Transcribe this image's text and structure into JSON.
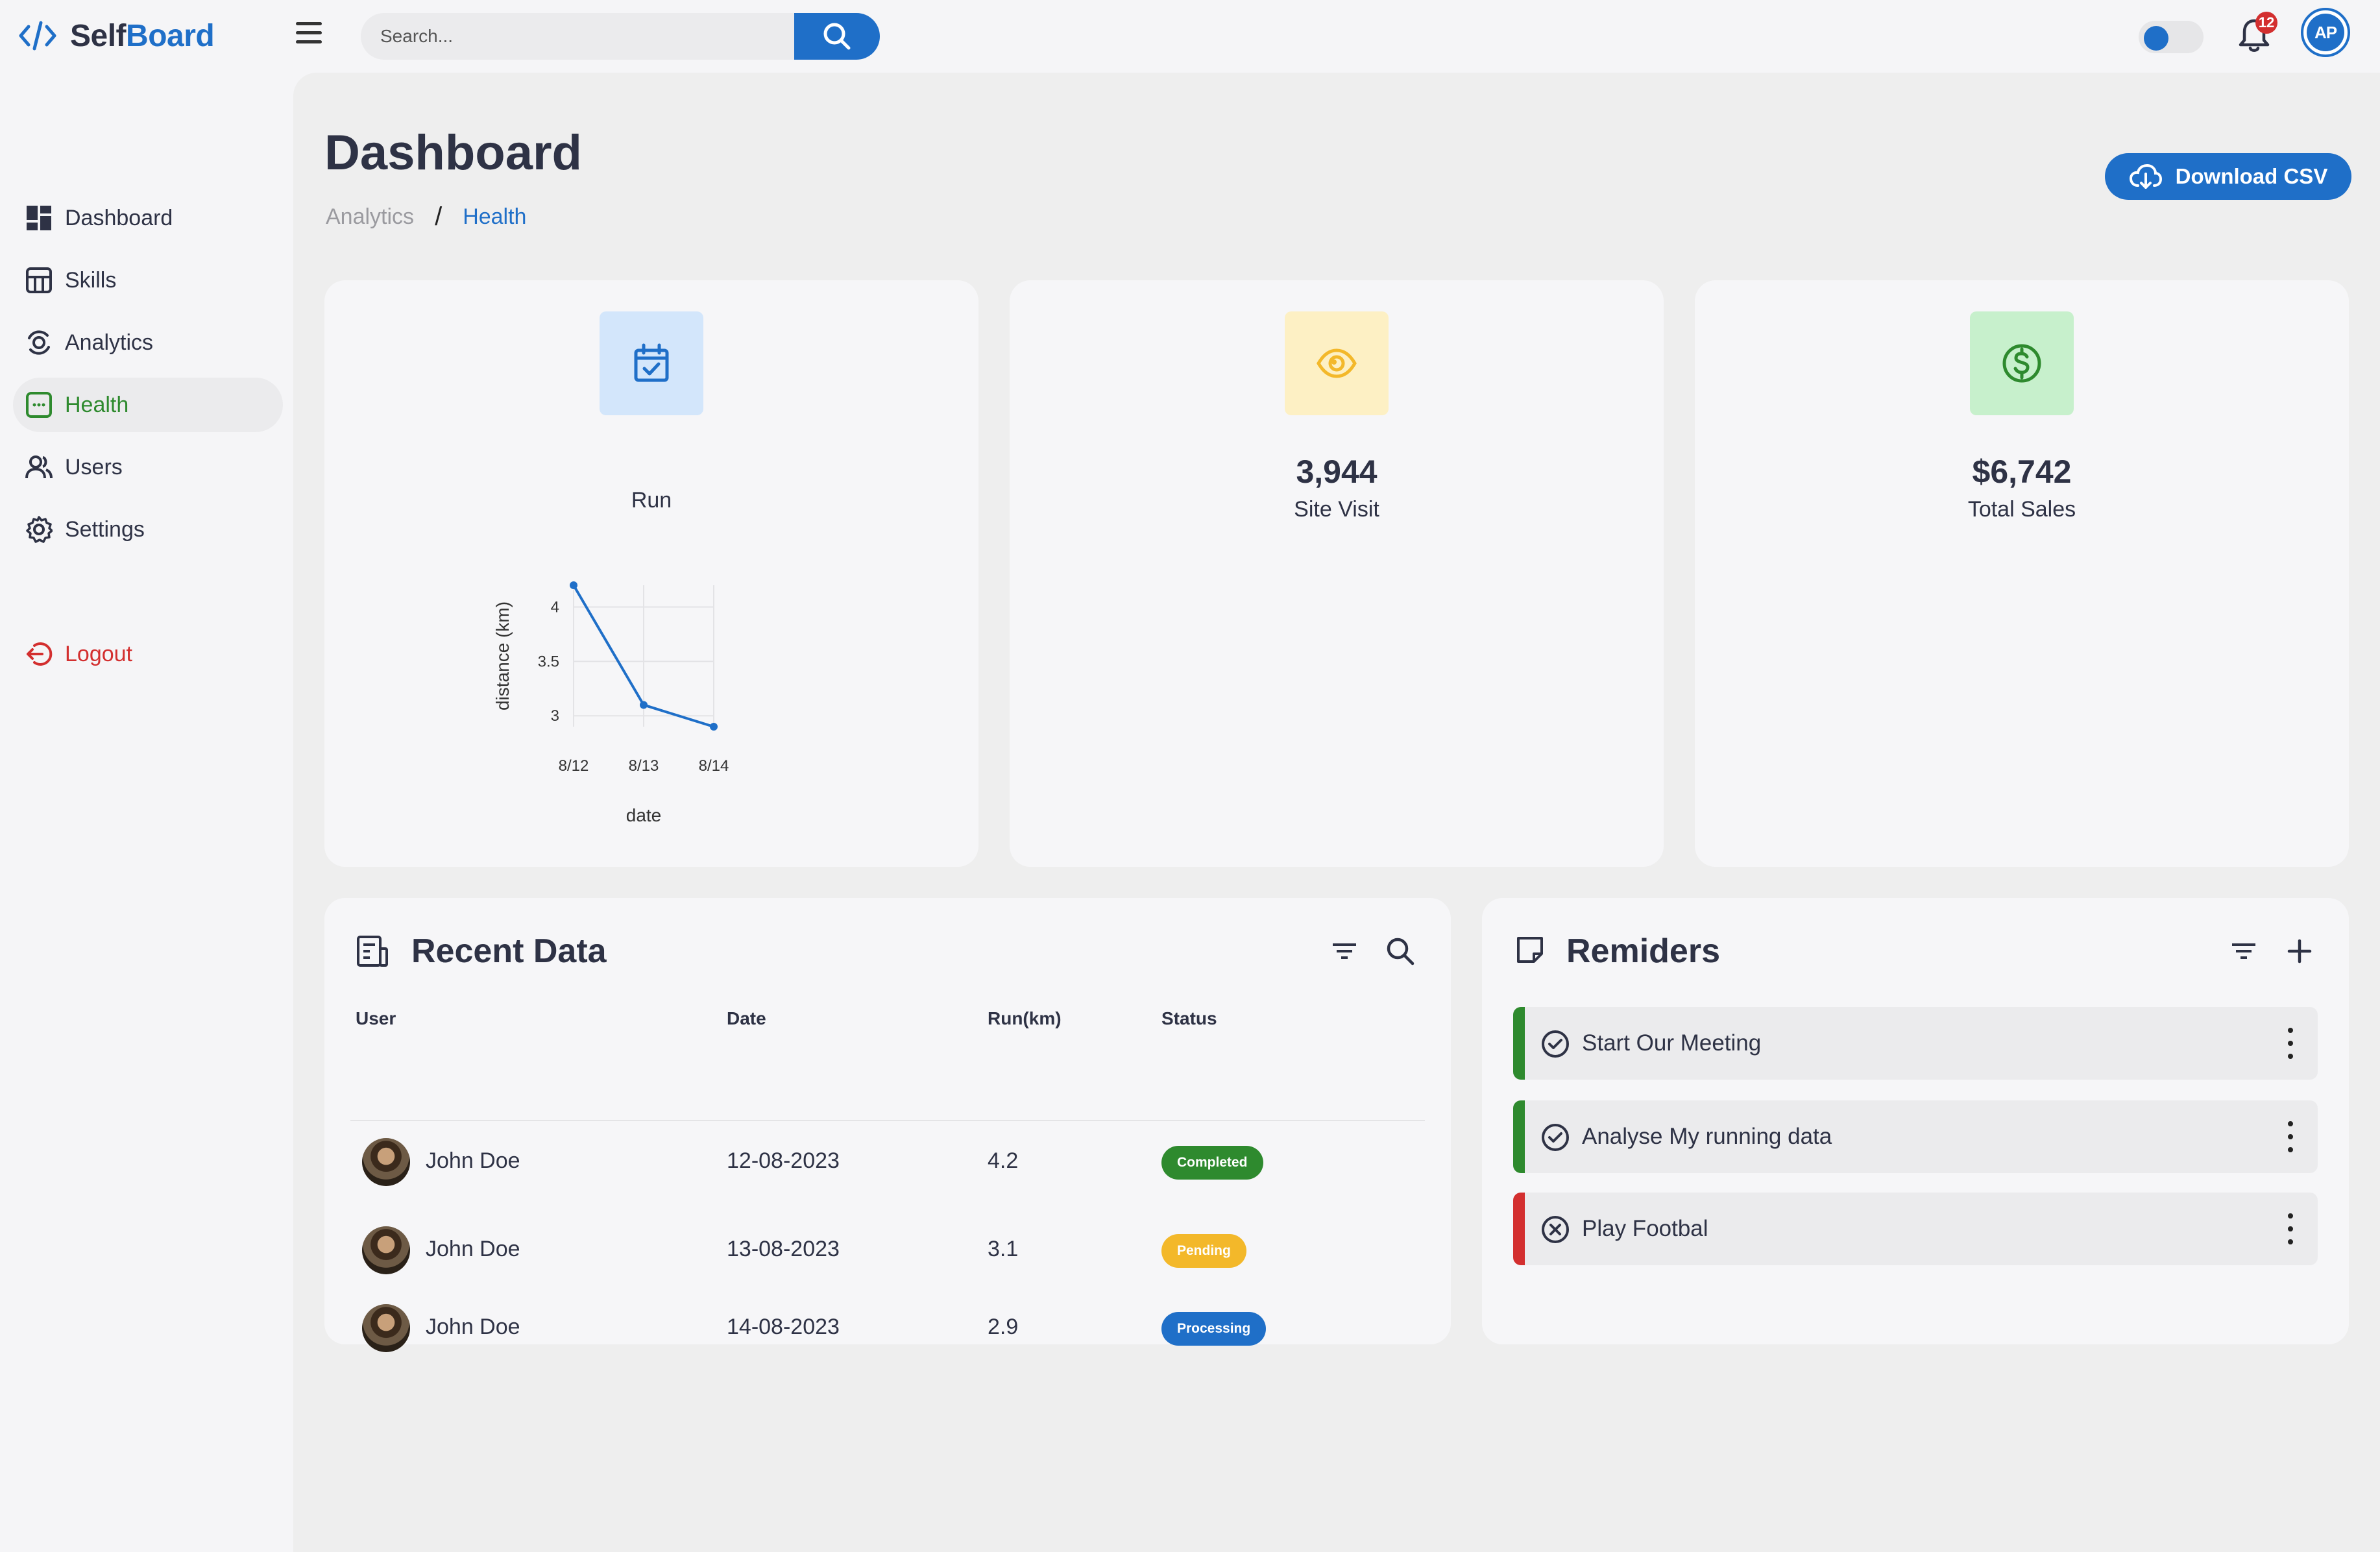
{
  "app": {
    "logo_part1": "Self",
    "logo_part2": "Board"
  },
  "search": {
    "placeholder": "Search..."
  },
  "notifications": {
    "count": "12"
  },
  "user": {
    "initials": "AP"
  },
  "sidebar": {
    "items": [
      {
        "label": "Dashboard",
        "icon": "dashboard-icon"
      },
      {
        "label": "Skills",
        "icon": "skills-icon"
      },
      {
        "label": "Analytics",
        "icon": "analytics-icon"
      },
      {
        "label": "Health",
        "icon": "health-icon",
        "active": true
      },
      {
        "label": "Users",
        "icon": "users-icon"
      },
      {
        "label": "Settings",
        "icon": "gear-icon"
      }
    ],
    "logout": "Logout"
  },
  "header": {
    "title": "Dashboard",
    "breadcrumb": [
      "Analytics",
      "/",
      "Health"
    ],
    "download_label": "Download CSV"
  },
  "stats": [
    {
      "title": "Run",
      "icon": "calendar-icon",
      "color": "#1f6fc8",
      "bg": "#d3e6fb"
    },
    {
      "value": "3,944",
      "label": "Site Visit",
      "icon": "eye-icon",
      "color": "#f3b82a",
      "bg": "#fdf0c4"
    },
    {
      "value": "$6,742",
      "label": "Total Sales",
      "icon": "dollar-icon",
      "color": "#2e8a2e",
      "bg": "#c7f0cc"
    }
  ],
  "chart_data": {
    "type": "line",
    "title": "Run",
    "xlabel": "date",
    "ylabel": "distance  (km)",
    "categories": [
      "8/12",
      "8/13",
      "8/14"
    ],
    "values": [
      4.2,
      3.1,
      2.9
    ],
    "yticks": [
      "3",
      "3.5",
      "4"
    ],
    "ylim": [
      2.9,
      4.2
    ],
    "grid": true,
    "color": "#1f6fc8"
  },
  "recent": {
    "title": "Recent Data",
    "columns": [
      "User",
      "Date",
      "Run(km)",
      "Status"
    ],
    "rows": [
      {
        "user": "John Doe",
        "date": "12-08-2023",
        "run": "4.2",
        "status": "Completed",
        "status_color": "#2e8a2e"
      },
      {
        "user": "John Doe",
        "date": "13-08-2023",
        "run": "3.1",
        "status": "Pending",
        "status_color": "#f3b82a"
      },
      {
        "user": "John Doe",
        "date": "14-08-2023",
        "run": "2.9",
        "status": "Processing",
        "status_color": "#1f6fc8"
      }
    ]
  },
  "reminders": {
    "title": "Remiders",
    "items": [
      {
        "text": "Start Our Meeting",
        "state": "done",
        "color": "#2e8a2e"
      },
      {
        "text": "Analyse My running data",
        "state": "done",
        "color": "#2e8a2e"
      },
      {
        "text": "Play Footbal",
        "state": "cancelled",
        "color": "#d32f2f"
      }
    ]
  }
}
